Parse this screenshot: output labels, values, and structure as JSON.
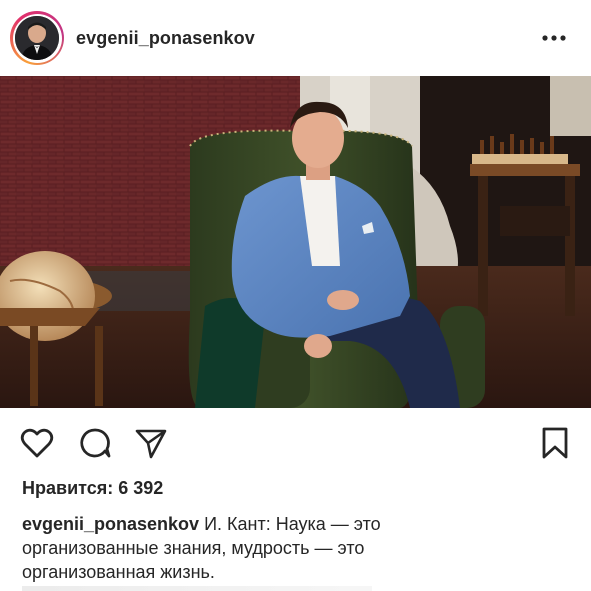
{
  "header": {
    "username": "evgenii_ponasenkov",
    "avatar_icon": "profile-photo",
    "more_icon": "more-horizontal-icon"
  },
  "photo": {
    "description_icon": "post-photo"
  },
  "actions": {
    "like_icon": "heart-icon",
    "comment_icon": "comment-icon",
    "share_icon": "paper-plane-icon",
    "save_icon": "bookmark-icon"
  },
  "likes": {
    "text": "Нравится: 6 392"
  },
  "caption": {
    "author": "evgenii_ponasenkov",
    "text": "И. Кант:  Наука — это организованные знания, мудрость — это организованная жизнь."
  },
  "colors": {
    "text": "#262626",
    "ring_start": "#f9a03a",
    "ring_end": "#c13584"
  }
}
